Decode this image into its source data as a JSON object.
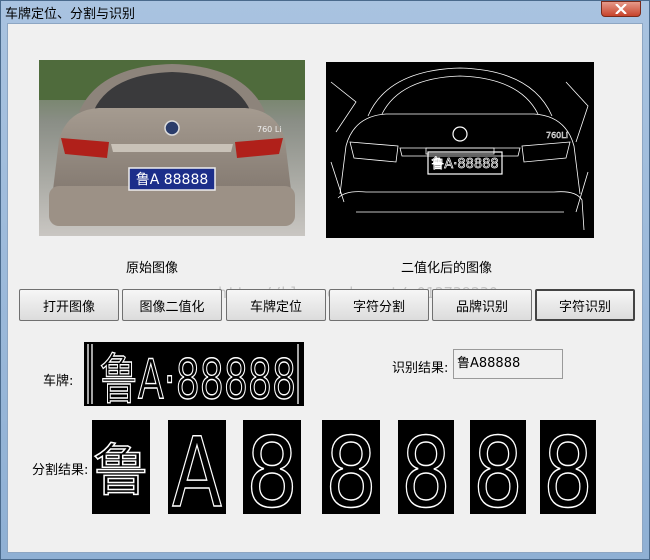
{
  "window": {
    "title": "车牌定位、分割与识别"
  },
  "images": {
    "original_caption": "原始图像",
    "binary_caption": "二值化后的图像",
    "original_plate_text": "鲁A 88888",
    "binary_plate_text": "鲁A·88888"
  },
  "buttons": [
    {
      "label": "打开图像"
    },
    {
      "label": "图像二值化"
    },
    {
      "label": "车牌定位"
    },
    {
      "label": "字符分割"
    },
    {
      "label": "品牌识别"
    },
    {
      "label": "字符识别"
    }
  ],
  "plate": {
    "label": "车牌:",
    "text": "鲁A·88888"
  },
  "result": {
    "label": "识别结果:",
    "value": "鲁A88888"
  },
  "segments": {
    "label": "分割结果:",
    "chars": [
      "鲁",
      "A",
      "8",
      "8",
      "8",
      "8",
      "8"
    ]
  },
  "watermark": "http://blog.csdn.net/u012739230"
}
